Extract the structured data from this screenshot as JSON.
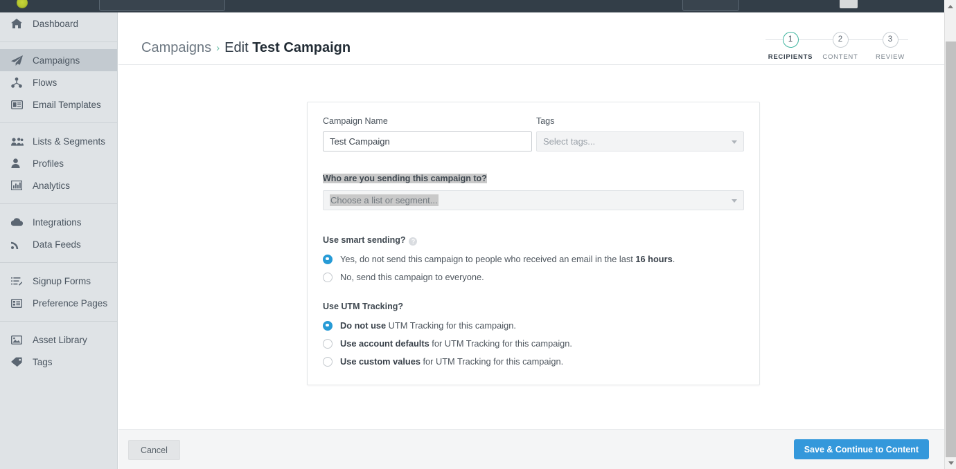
{
  "topbar": {
    "logo_icon": "klaviyo-logo-icon",
    "search_placeholder": "",
    "account_box_label": "",
    "avatar_icon": "user-avatar-icon"
  },
  "sidebar": {
    "groups": [
      {
        "items": [
          {
            "label": "Dashboard",
            "icon": "home-icon",
            "active": false
          }
        ]
      },
      {
        "items": [
          {
            "label": "Campaigns",
            "icon": "paper-plane-icon",
            "active": true
          },
          {
            "label": "Flows",
            "icon": "flow-nodes-icon",
            "active": false
          },
          {
            "label": "Email Templates",
            "icon": "template-card-icon",
            "active": false
          }
        ]
      },
      {
        "items": [
          {
            "label": "Lists & Segments",
            "icon": "people-group-icon",
            "active": false
          },
          {
            "label": "Profiles",
            "icon": "person-icon",
            "active": false
          },
          {
            "label": "Analytics",
            "icon": "bar-chart-icon",
            "active": false
          }
        ]
      },
      {
        "items": [
          {
            "label": "Integrations",
            "icon": "cloud-icon",
            "active": false
          },
          {
            "label": "Data Feeds",
            "icon": "rss-feed-icon",
            "active": false
          }
        ]
      },
      {
        "items": [
          {
            "label": "Signup Forms",
            "icon": "list-edit-icon",
            "active": false
          },
          {
            "label": "Preference Pages",
            "icon": "page-list-icon",
            "active": false
          }
        ]
      },
      {
        "items": [
          {
            "label": "Asset Library",
            "icon": "image-icon",
            "active": false
          },
          {
            "label": "Tags",
            "icon": "tag-icon",
            "active": false
          }
        ]
      }
    ]
  },
  "header": {
    "breadcrumb_root": "Campaigns",
    "breadcrumb_separator": "›",
    "breadcrumb_action": "Edit",
    "breadcrumb_name": "Test Campaign",
    "steps": [
      {
        "number": "1",
        "label": "RECIPIENTS",
        "active": true
      },
      {
        "number": "2",
        "label": "CONTENT",
        "active": false
      },
      {
        "number": "3",
        "label": "REVIEW",
        "active": false
      }
    ]
  },
  "form": {
    "campaign_name_label": "Campaign Name",
    "campaign_name_value": "Test Campaign",
    "campaign_name_placeholder": "Campaign Name",
    "tags_label": "Tags",
    "tags_placeholder": "Select tags...",
    "audience_label": "Who are you sending this campaign to?",
    "audience_placeholder": "Choose a list or segment...",
    "smart_sending": {
      "label": "Use smart sending?",
      "help_icon": "question-mark-icon",
      "help_glyph": "?",
      "options": [
        {
          "selected": true,
          "text_before": "Yes",
          "text_mid": ", do not send this campaign to people who received an email in the last ",
          "text_bold": "16 hours",
          "text_after": "."
        },
        {
          "selected": false,
          "text_before": "No",
          "text_mid": ", send this campaign to everyone.",
          "text_bold": "",
          "text_after": ""
        }
      ]
    },
    "utm_tracking": {
      "label": "Use UTM Tracking?",
      "options": [
        {
          "selected": true,
          "bold": "Do not use",
          "rest": " UTM Tracking for this campaign."
        },
        {
          "selected": false,
          "bold": "Use account defaults",
          "rest": " for UTM Tracking for this campaign."
        },
        {
          "selected": false,
          "bold": "Use custom values",
          "rest": " for UTM Tracking for this campaign."
        }
      ]
    }
  },
  "footer": {
    "cancel_label": "Cancel",
    "primary_label": "Save & Continue to Content"
  },
  "colors": {
    "accent_primary": "#3498db",
    "accent_teal": "#3fb5a0",
    "sidebar_bg": "#dfe3e6",
    "topbar_bg": "#333e48",
    "selection_highlight": "#c9c9c9"
  }
}
